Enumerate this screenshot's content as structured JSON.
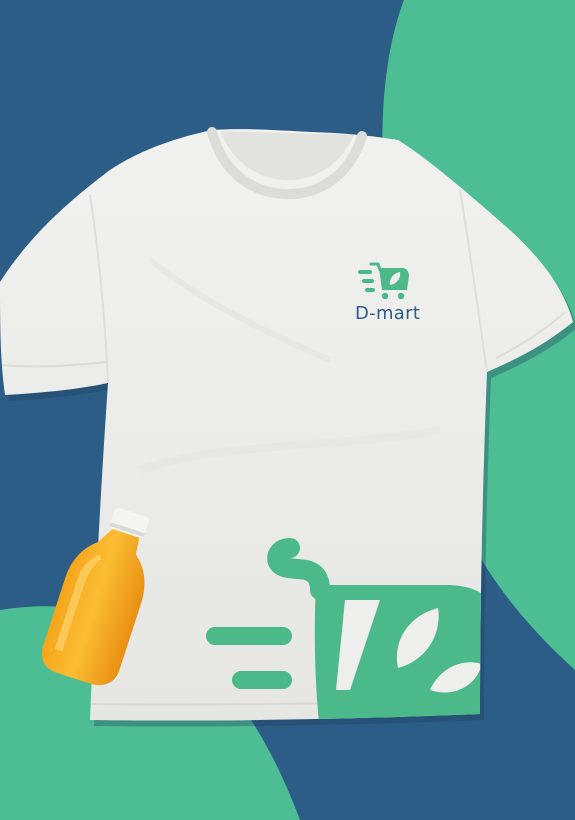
{
  "brand": {
    "name": "D-mart"
  },
  "colors": {
    "background_blue": "#2c5d87",
    "background_green": "#4dbd94",
    "shirt_white": "#eeeeec",
    "logo_green": "#4cb98b",
    "logo_text_blue": "#2d5b8a",
    "juice_orange": "#f2a21c",
    "cap_white": "#f4f4f2"
  },
  "objects": [
    {
      "name": "t-shirt",
      "color": "white"
    },
    {
      "name": "juice-bottle",
      "color": "orange"
    },
    {
      "name": "chest-logo",
      "icon": "shopping-cart-leaf-icon"
    },
    {
      "name": "large-hem-logo",
      "icon": "shopping-cart-leaf-icon"
    }
  ]
}
